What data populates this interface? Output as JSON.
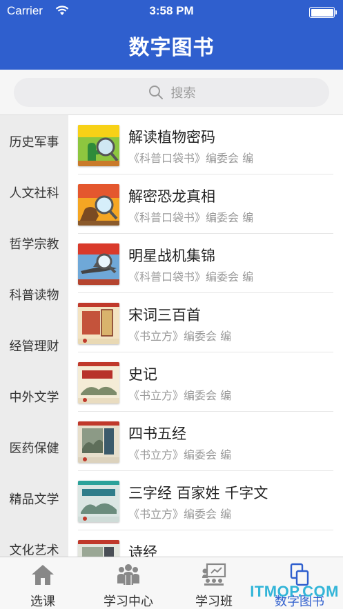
{
  "status_bar": {
    "carrier": "Carrier",
    "time": "3:58 PM"
  },
  "nav": {
    "title": "数字图书"
  },
  "search": {
    "placeholder": "搜索"
  },
  "categories": [
    "历史军事",
    "人文社科",
    "哲学宗教",
    "科普读物",
    "经管理财",
    "中外文学",
    "医药保健",
    "精品文学",
    "文化艺术"
  ],
  "books": [
    {
      "title": "解读植物密码",
      "author": "《科普口袋书》编委会 编"
    },
    {
      "title": "解密恐龙真相",
      "author": "《科普口袋书》编委会 编"
    },
    {
      "title": "明星战机集锦",
      "author": "《科普口袋书》编委会 编"
    },
    {
      "title": "宋词三百首",
      "author": "《书立方》编委会 编"
    },
    {
      "title": "史记",
      "author": "《书立方》编委会 编"
    },
    {
      "title": "四书五经",
      "author": "《书立方》编委会 编"
    },
    {
      "title": "三字经 百家姓 千字文",
      "author": "《书立方》编委会 编"
    },
    {
      "title": "诗经",
      "author": ""
    }
  ],
  "tabs": [
    {
      "label": "选课",
      "icon": "home-icon",
      "active": false
    },
    {
      "label": "学习中心",
      "icon": "group-icon",
      "active": false
    },
    {
      "label": "学习班",
      "icon": "classroom-icon",
      "active": false
    },
    {
      "label": "数字图书",
      "icon": "digital-book-icon",
      "active": true
    }
  ],
  "watermark": "ITMOP.COM",
  "colors": {
    "primary": "#2f5fce",
    "sidebar": "#ececec",
    "watermark": "#33b5d8"
  }
}
